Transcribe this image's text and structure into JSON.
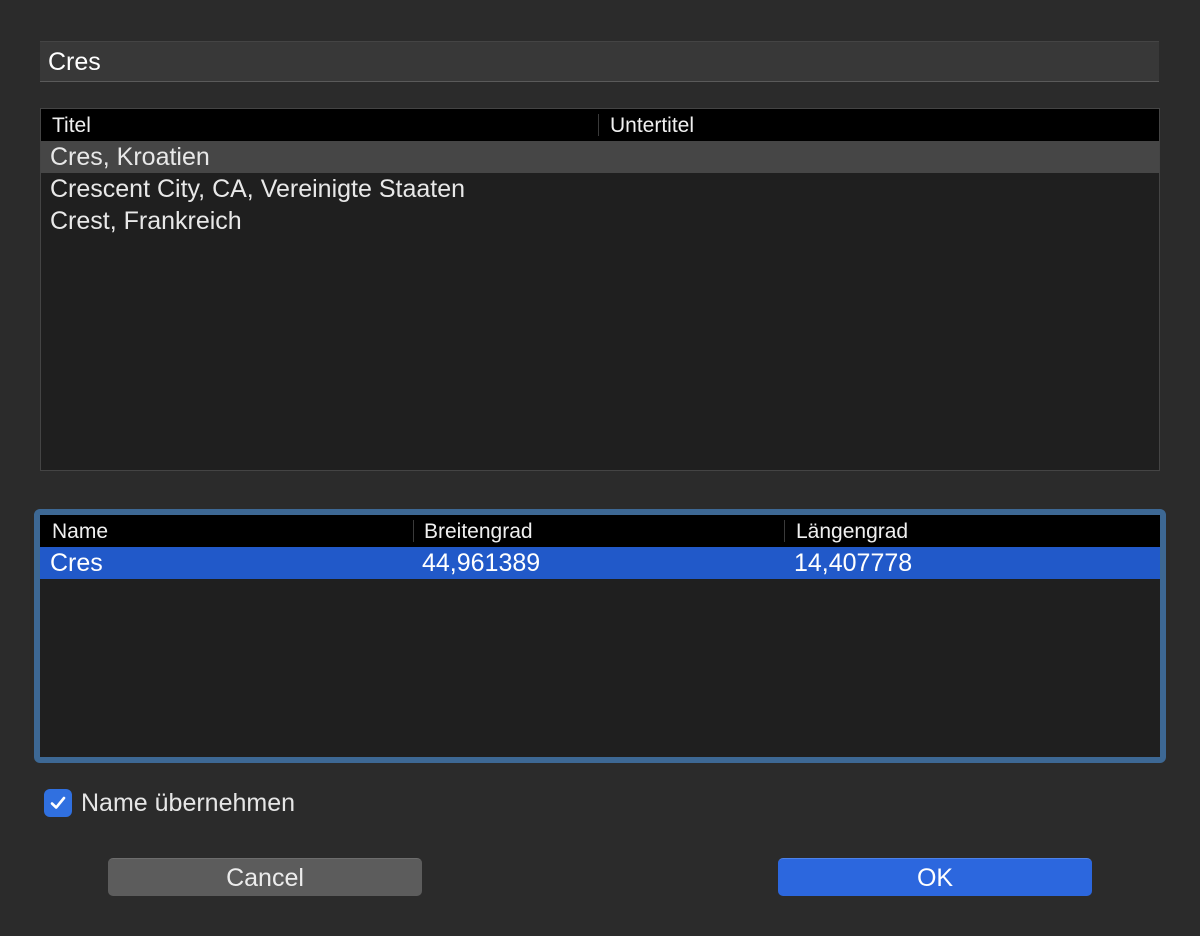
{
  "search": {
    "value": "Cres"
  },
  "results_table": {
    "columns": [
      "Titel",
      "Untertitel"
    ],
    "rows": [
      {
        "title": "Cres, Kroatien",
        "subtitle": ""
      },
      {
        "title": "Crescent City, CA, Vereinigte Staaten",
        "subtitle": ""
      },
      {
        "title": "Crest, Frankreich",
        "subtitle": ""
      }
    ],
    "selected_index": 0
  },
  "coords_table": {
    "columns": [
      "Name",
      "Breitengrad",
      "Längengrad"
    ],
    "rows": [
      {
        "name": "Cres",
        "latitude": "44,961389",
        "longitude": "14,407778"
      }
    ],
    "selected_index": 0
  },
  "options": {
    "take_name_label": "Name übernehmen",
    "take_name_checked": true,
    "checkbox_icon": "checkmark-icon"
  },
  "buttons": {
    "cancel_label": "Cancel",
    "ok_label": "OK"
  },
  "colors": {
    "accent": "#2c67de",
    "focus_ring": "#3d6894",
    "selection_blue": "#2159c9"
  }
}
